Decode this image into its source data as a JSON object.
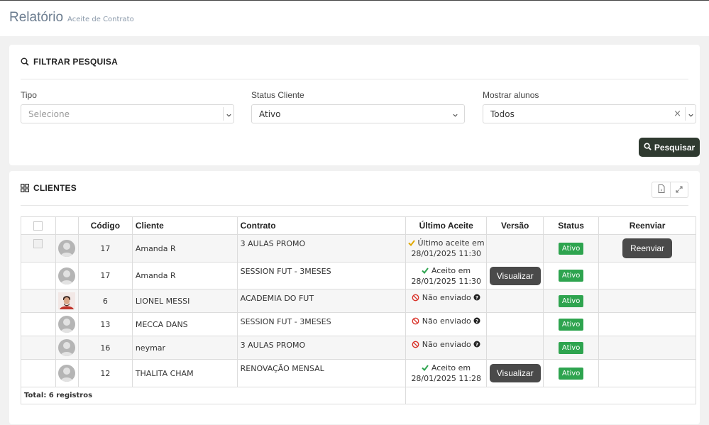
{
  "header": {
    "title": "Relatório",
    "subtitle": "Aceite de Contrato"
  },
  "filter": {
    "heading": "FILTRAR PESQUISA",
    "tipo": {
      "label": "Tipo",
      "placeholder": "Selecione"
    },
    "status": {
      "label": "Status Cliente",
      "value": "Ativo"
    },
    "mostrar": {
      "label": "Mostrar alunos",
      "value": "Todos"
    },
    "search_button": "Pesquisar"
  },
  "clients": {
    "heading": "CLIENTES",
    "columns": {
      "codigo": "Código",
      "cliente": "Cliente",
      "contrato": "Contrato",
      "ultimo": "Último Aceite",
      "versao": "Versão",
      "status": "Status",
      "reenviar": "Reenviar"
    },
    "rows": [
      {
        "code": "17",
        "name": "Amanda R",
        "contract": "3 AULAS PROMO",
        "accept_line1": "Último aceite em",
        "accept_line2": "28/01/2025 11:30",
        "accept_state": "partial",
        "status": "Ativo",
        "resend": "Reenviar"
      },
      {
        "code": "17",
        "name": "Amanda R",
        "contract": "SESSION FUT - 3MESES",
        "accept_line1": "Aceito em",
        "accept_line2": "28/01/2025 11:30",
        "accept_state": "accepted",
        "version": "Visualizar",
        "status": "Ativo"
      },
      {
        "code": "6",
        "name": "LIONEL MESSI",
        "contract": "ACADEMIA DO FUT",
        "accept_line1": "Não enviado",
        "accept_state": "not_sent",
        "status": "Ativo"
      },
      {
        "code": "13",
        "name": "MECCA DANS",
        "contract": "SESSION FUT - 3MESES",
        "accept_line1": "Não enviado",
        "accept_state": "not_sent",
        "status": "Ativo"
      },
      {
        "code": "16",
        "name": "neymar",
        "contract": "3 AULAS PROMO",
        "accept_line1": "Não enviado",
        "accept_state": "not_sent",
        "status": "Ativo"
      },
      {
        "code": "12",
        "name": "THALITA CHAM",
        "contract": "RENOVAÇÃO MENSAL",
        "accept_line1": "Aceito em",
        "accept_line2": "28/01/2025 11:28",
        "accept_state": "accepted",
        "version": "Visualizar",
        "status": "Ativo"
      }
    ],
    "total": "Total: 6 registros"
  },
  "colors": {
    "accent_dark": "#2f3a30",
    "status_green": "#2ea44f",
    "check_green": "#2ea44f",
    "check_yellow": "#e0a800",
    "ban_red": "#d9342b"
  }
}
